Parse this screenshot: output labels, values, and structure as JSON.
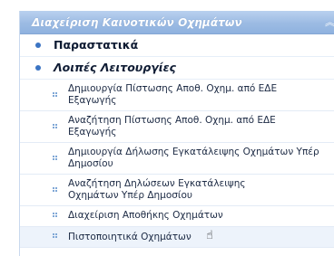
{
  "panel": {
    "title": "Διαχείριση Καινοτικών Οχημάτων",
    "collapse_icon": "double-chevron-up-icon"
  },
  "categories": [
    {
      "label": "Παραστατικά",
      "icon": "bullet-icon"
    },
    {
      "label": "Λοιπές Λειτουργίες",
      "icon": "bullet-icon"
    }
  ],
  "items": [
    {
      "label": "Δημιουργία Πίστωσης Αποθ. Οχημ. από ΕΔΕ Εξαγωγής"
    },
    {
      "label": "Αναζήτηση Πίστωσης Αποθ. Οχημ. από ΕΔΕ Εξαγωγής"
    },
    {
      "label": "Δημιουργία Δήλωσης Εγκατάλειψης Οχημάτων Υπέρ Δημοσίου"
    },
    {
      "label": "Αναζήτηση Δηλώσεων Εγκατάλειψης Οχημάτων Υπέρ Δημοσίου"
    },
    {
      "label": "Διαχείριση Αποθήκης Οχημάτων"
    },
    {
      "label": "Πιστοποιητικά Οχημάτων"
    }
  ],
  "colors": {
    "header_bg": "#9cbbe3",
    "bullet": "#3b74c3",
    "hover_bg": "#edf3fb"
  }
}
